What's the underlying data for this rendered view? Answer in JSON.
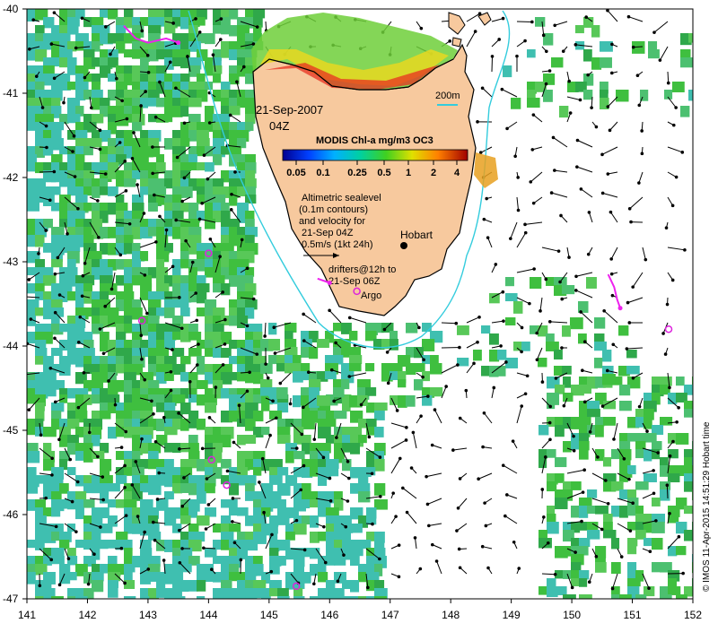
{
  "map": {
    "date_label": "21-Sep-2007",
    "time_label": "04Z",
    "isobath_label": "200m",
    "city_label": "Hobart",
    "colorbar_title": "MODIS Chl-a mg/m3 OC3",
    "colorbar_ticks": [
      "0.05",
      "0.1",
      "0.25",
      "0.5",
      "1",
      "2",
      "4"
    ],
    "altimetry_note": [
      "Altimetric sealevel",
      "(0.1m contours)",
      "and velocity for",
      "21-Sep 04Z",
      "0.5m/s (1kt 24h)"
    ],
    "drifters_note": [
      "drifters@12h to",
      "21-Sep 06Z"
    ],
    "argo_label": "Argo",
    "credit": "© IMOS 11-Apr-2015 14:51:29 Hobart time",
    "x_ticks": [
      "141",
      "142",
      "143",
      "144",
      "145",
      "146",
      "147",
      "148",
      "149",
      "150",
      "151",
      "152"
    ],
    "y_ticks": [
      "-40",
      "-41",
      "-42",
      "-43",
      "-44",
      "-45",
      "-46",
      "-47"
    ],
    "colors": {
      "land": "#f7c99e",
      "coast": "#000000",
      "isobath": "#33ccdd",
      "drifter": "#ee22ee",
      "argo": "#dd22dd",
      "chl_low": "#3fbfb0",
      "chl_mid": "#3fbf3f",
      "chl_high": "#e8e020"
    },
    "argo_floats_lonlat": [
      [
        142.9,
        -43.7
      ],
      [
        144.05,
        -45.35
      ],
      [
        144.3,
        -45.65
      ],
      [
        145.45,
        -46.85
      ],
      [
        146.45,
        -43.35
      ],
      [
        151.6,
        -43.8
      ],
      [
        144.0,
        -42.9
      ]
    ],
    "drifter_tracks_lonlat": [
      [
        [
          142.6,
          -40.2
        ],
        [
          142.8,
          -40.35
        ],
        [
          143.0,
          -40.4
        ],
        [
          143.3,
          -40.35
        ],
        [
          143.5,
          -40.4
        ]
      ],
      [
        [
          150.6,
          -43.15
        ],
        [
          150.7,
          -43.3
        ],
        [
          150.75,
          -43.45
        ],
        [
          150.8,
          -43.55
        ]
      ],
      [
        [
          145.8,
          -43.2
        ],
        [
          146.0,
          -43.25
        ]
      ]
    ]
  }
}
